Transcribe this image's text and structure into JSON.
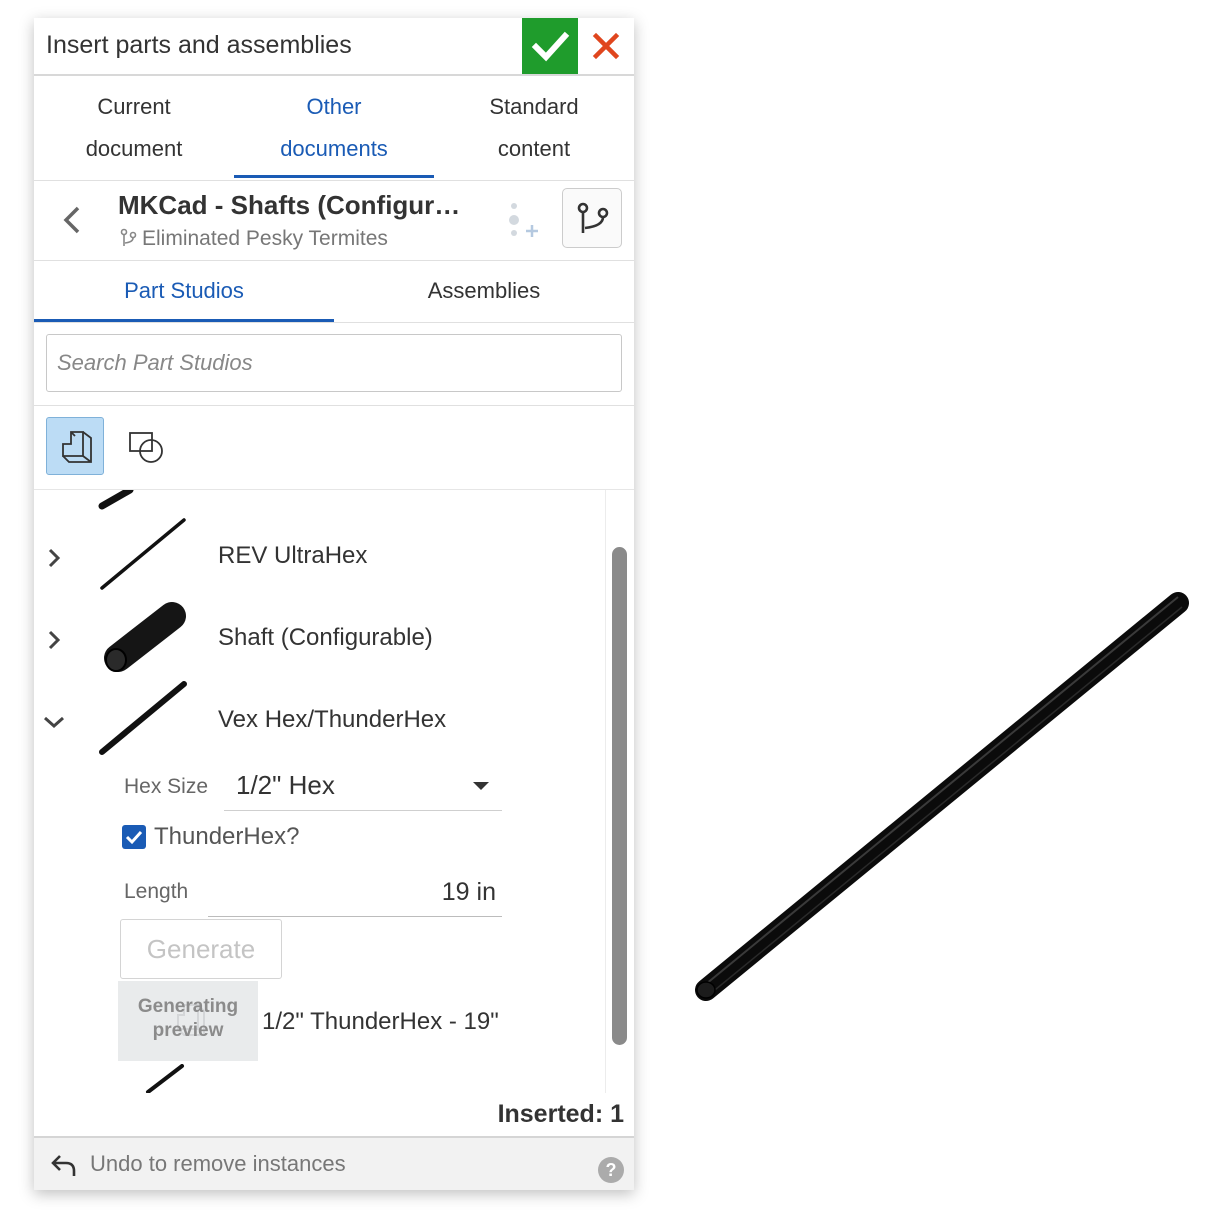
{
  "dialog": {
    "title": "Insert parts and assemblies",
    "accent_color": "#1a5bb5",
    "confirm_color": "#1f9c2c",
    "cancel_color": "#e0461e"
  },
  "tabs": [
    {
      "line1": "Current",
      "line2": "document",
      "active": false
    },
    {
      "line1": "Other",
      "line2": "documents",
      "active": true
    },
    {
      "line1": "Standard",
      "line2": "content",
      "active": false
    }
  ],
  "document": {
    "title": "MKCad - Shafts (Configur…",
    "branch": "Eliminated Pesky Termites"
  },
  "subtabs": [
    {
      "label": "Part Studios",
      "active": true
    },
    {
      "label": "Assemblies",
      "active": false
    }
  ],
  "search": {
    "placeholder": "Search Part Studios"
  },
  "filters": [
    {
      "icon": "part-studio-filter-icon",
      "active": true
    },
    {
      "icon": "sketch-filter-icon",
      "active": false
    }
  ],
  "list": {
    "items": [
      {
        "label": "REV UltraHex",
        "expanded": false
      },
      {
        "label": "Shaft (Configurable)",
        "expanded": false
      },
      {
        "label": "Vex Hex/ThunderHex",
        "expanded": true
      }
    ],
    "config": {
      "hex_size_label": "Hex Size",
      "hex_size_value": "1/2\" Hex",
      "thunderhex_label": "ThunderHex?",
      "thunderhex_checked": true,
      "length_label": "Length",
      "length_value": "19 in",
      "generate_label": "Generate",
      "preview_line1": "Generating",
      "preview_line2": "preview",
      "generated_label": "1/2\" ThunderHex - 19\""
    }
  },
  "inserted": "Inserted: 1",
  "footer": {
    "undo_text": "Undo to remove instances",
    "help": "?"
  }
}
